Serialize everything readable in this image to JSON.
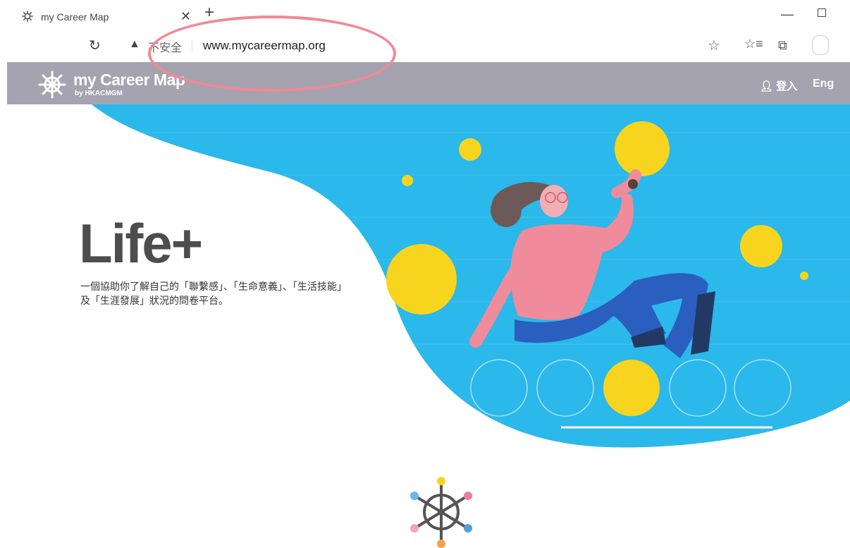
{
  "browser": {
    "tab_title": "my Career Map",
    "tab_close": "✕",
    "new_tab": "+",
    "minimize": "—",
    "security_warning": "不安全",
    "address": "www.mycareermap.org"
  },
  "site": {
    "logo_text": "my Career Map",
    "logo_sub": "by HKACMGM",
    "login": "登入",
    "language": "Eng"
  },
  "hero": {
    "title": "Life+",
    "description_line1": "一個協助你了解自己的「聯繫感」、「生命意義」、「生活技能」",
    "description_line2": "及「生涯發展」狀況的問卷平台。"
  },
  "colors": {
    "header_bg": "#a5a3af",
    "hero_blue": "#2bb8ea",
    "accent_yellow": "#f7d51e",
    "annotation_circle": "#ef8a96"
  }
}
